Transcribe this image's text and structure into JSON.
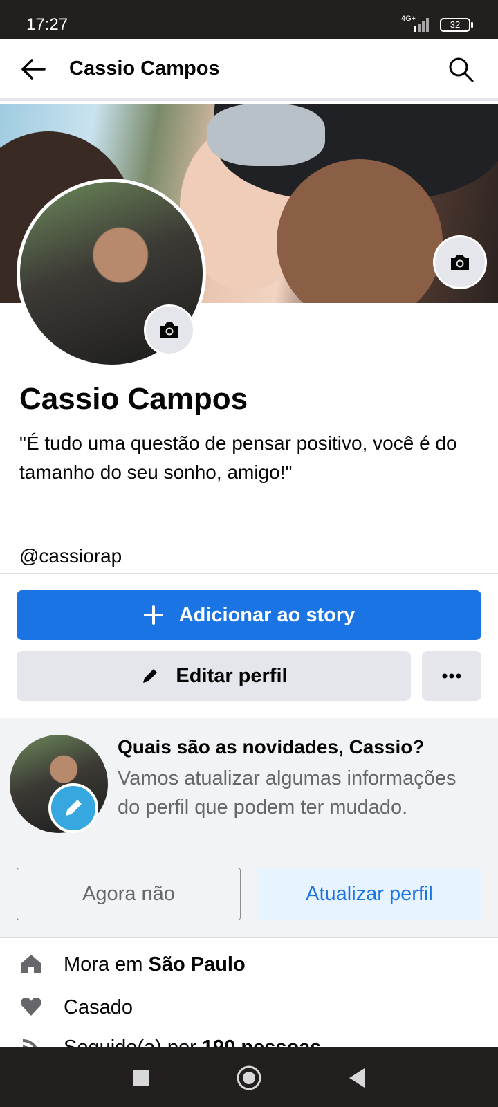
{
  "status_bar": {
    "time": "17:27",
    "network": "4G+",
    "battery": "32"
  },
  "header": {
    "title": "Cassio Campos",
    "back_icon": "arrow-left-icon",
    "search_icon": "search-icon"
  },
  "profile": {
    "name": "Cassio Campos",
    "bio": "\"É tudo uma questão de pensar positivo, você é do tamanho do seu sonho, amigo!\"",
    "username": "@cassiorap"
  },
  "actions": {
    "add_story_label": "Adicionar ao story",
    "edit_profile_label": "Editar perfil"
  },
  "update_card": {
    "title": "Quais são as novidades, Cassio?",
    "text": "Vamos atualizar algumas informações do perfil que podem ter mudado.",
    "later_label": "Agora não",
    "update_label": "Atualizar perfil"
  },
  "details": {
    "lives_prefix": "Mora em ",
    "lives_city": "São Paulo",
    "relationship": "Casado",
    "followers_prefix": "Seguido(a) por ",
    "followers_count": "190 pessoas"
  },
  "colors": {
    "primary": "#1b74e4",
    "secondary_bg": "#e4e6eb",
    "status_bar": "#231f1e"
  }
}
